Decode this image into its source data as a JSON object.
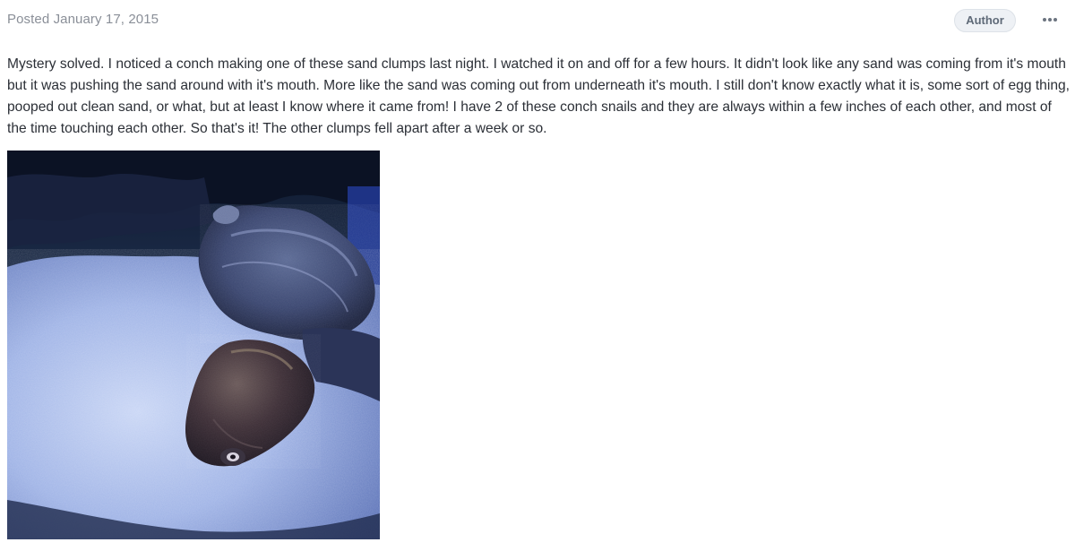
{
  "post": {
    "posted_label": "Posted January 17, 2015",
    "author_badge": "Author",
    "more_icon": "ellipsis-icon",
    "body_text": "Mystery solved. I noticed a conch making one of these sand clumps last night. I watched it on and off for a few hours. It didn't look like any sand was coming from it's mouth but it was pushing the sand around with it's mouth. More like the sand was coming out from underneath it's mouth. I still don't know exactly what it is, some sort of egg thing, pooped out clean sand, or what, but at least I know where it came from! I have 2 of these conch snails and they are always within a few inches of each other, and most of the time touching each other. So that's it! The other clumps fell apart after a week or so."
  },
  "colors": {
    "meta_text": "#8a8f98",
    "body_text": "#2b2f36",
    "badge_bg": "#eef1f5",
    "badge_text": "#5f6a78"
  }
}
